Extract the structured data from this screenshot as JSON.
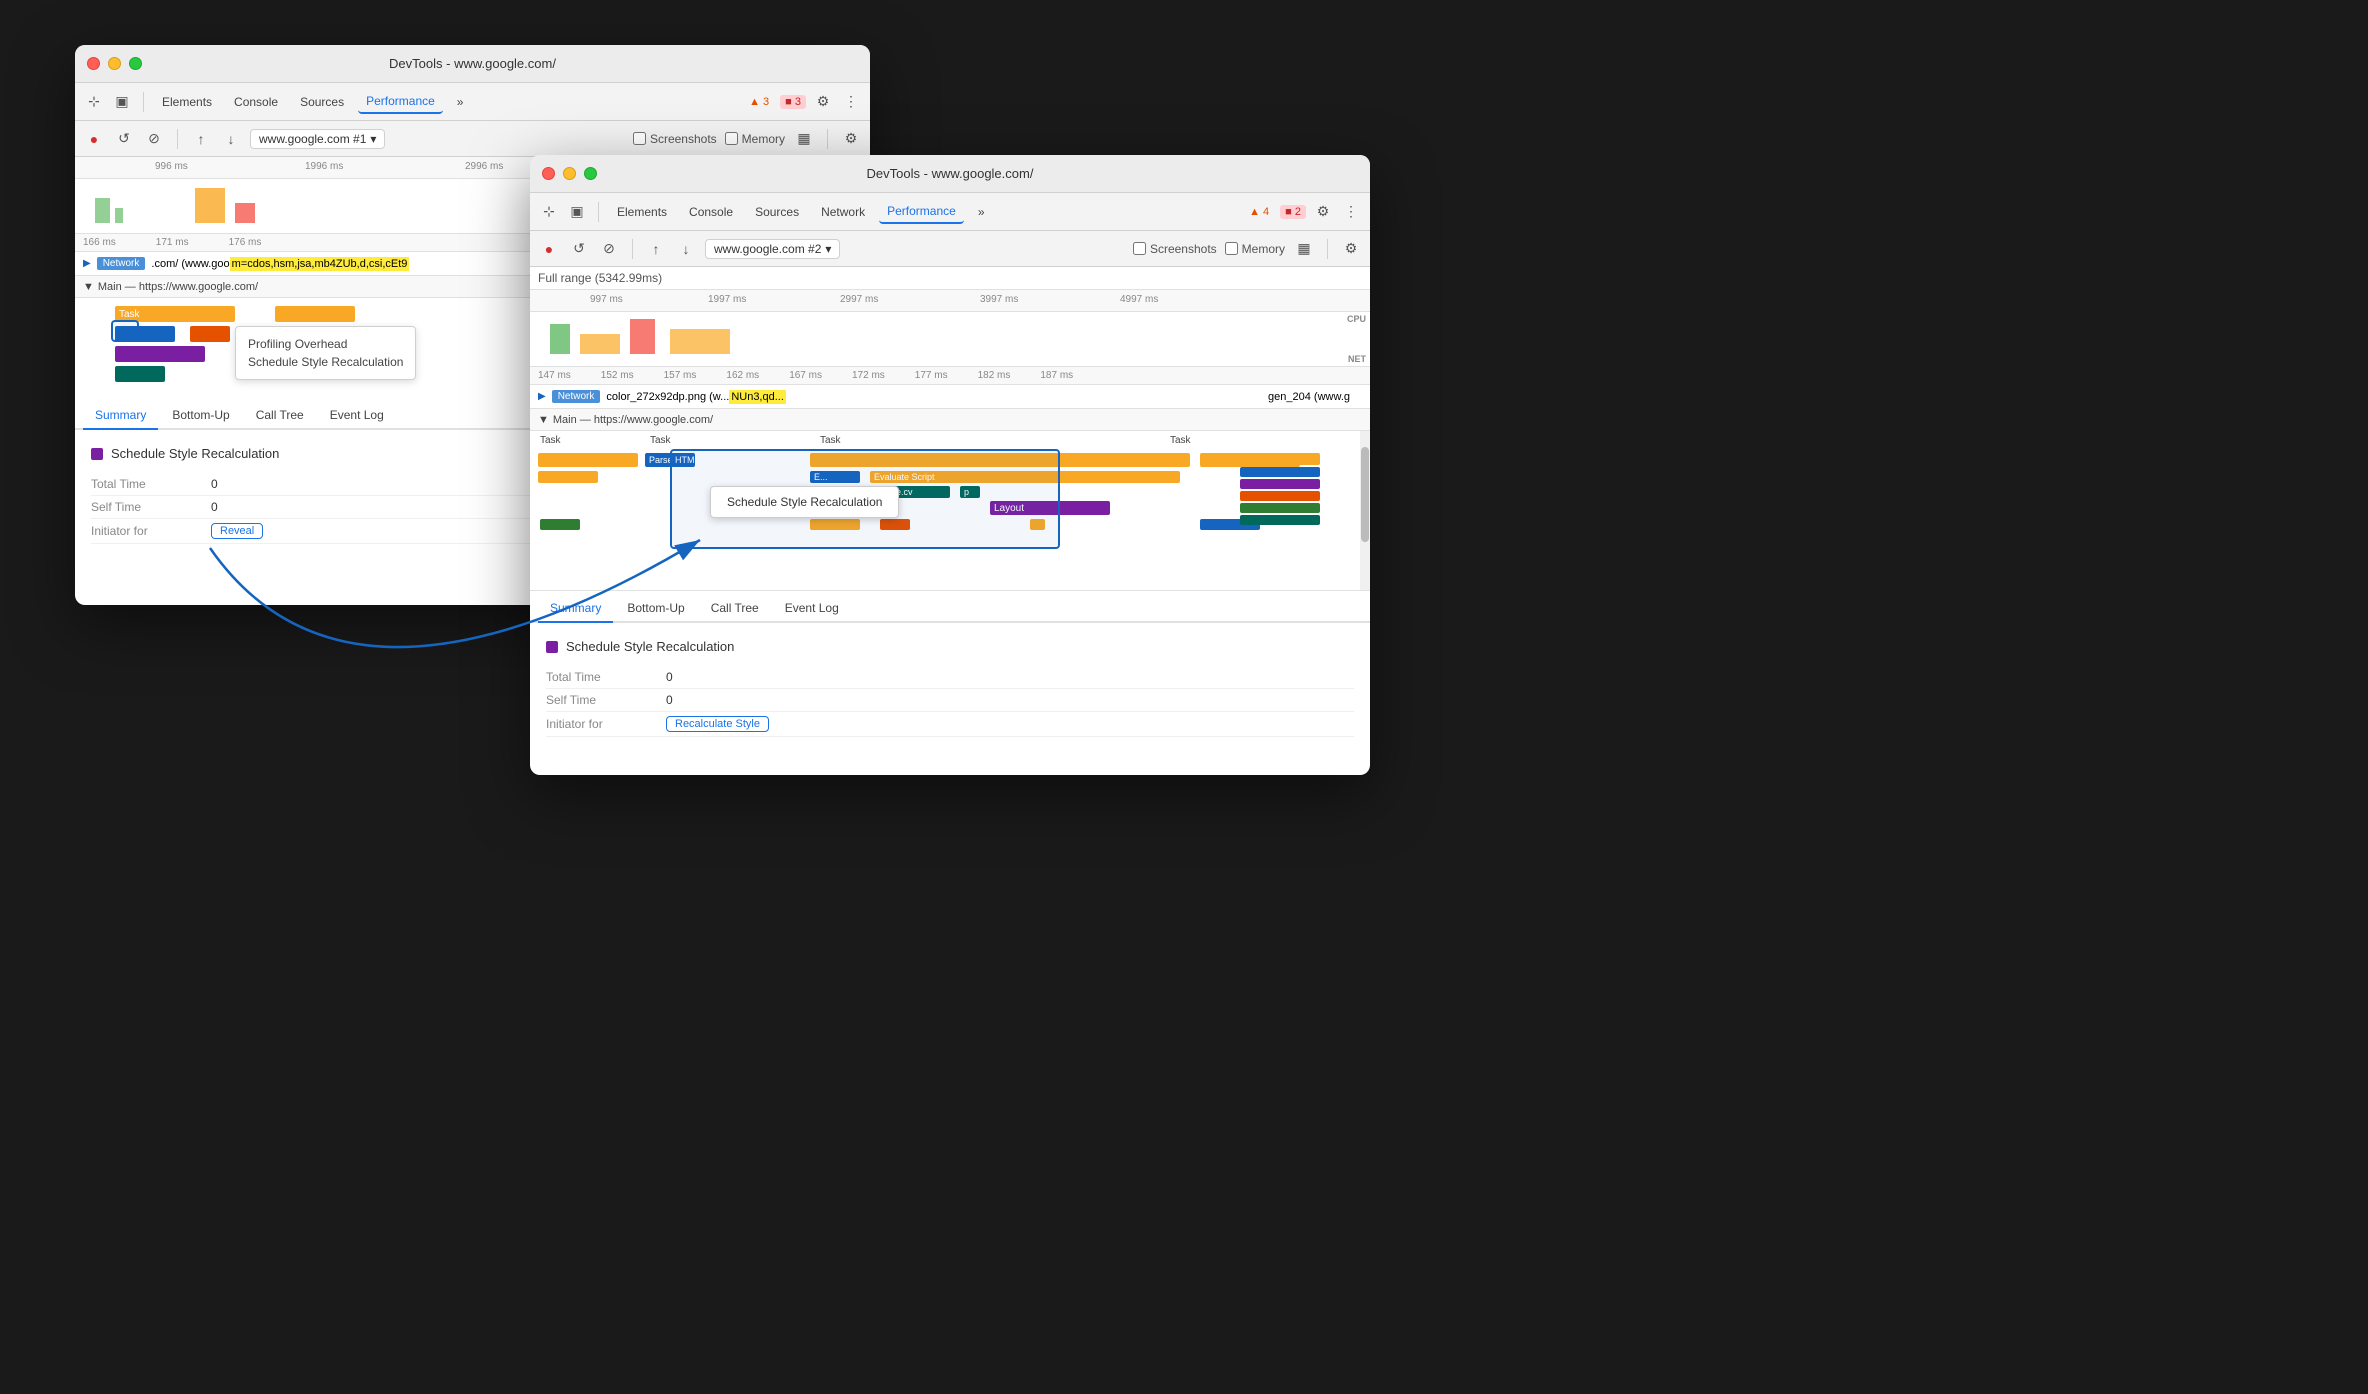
{
  "background_color": "#1a1a1a",
  "window_back": {
    "title": "DevTools - www.google.com/",
    "nav_items": [
      "Elements",
      "Console",
      "Sources",
      "Performance",
      "»"
    ],
    "active_nav": "Performance",
    "warnings": "▲ 3",
    "errors": "■ 3",
    "url": "www.google.com #1",
    "checkboxes": [
      "Screenshots",
      "Memory"
    ],
    "ruler_ticks": [
      "996 ms",
      "1996 ms",
      "2996 ms"
    ],
    "small_ticks": [
      "166 ms",
      "171 ms",
      "176 ms"
    ],
    "network_label": "Network",
    "network_url": ".com/ (www.goo",
    "network_params": "m=cdos,hsm,jsa,mb4ZUb,d,csi,cEt9",
    "main_label": "Main — https://www.google.com/",
    "task_label": "Task",
    "tooltip_items": [
      "Profiling Overhead",
      "Schedule Style Recalculation"
    ],
    "tabs": [
      "Summary",
      "Bottom-Up",
      "Call Tree",
      "Event Log"
    ],
    "active_tab": "Summary",
    "summary_title": "Schedule Style Recalculation",
    "total_time_label": "Total Time",
    "total_time_value": "0",
    "self_time_label": "Self Time",
    "self_time_value": "0",
    "initiator_label": "Initiator for",
    "reveal_label": "Reveal"
  },
  "window_front": {
    "title": "DevTools - www.google.com/",
    "nav_items": [
      "",
      "Elements",
      "Console",
      "Sources",
      "Network",
      "Performance",
      "»"
    ],
    "active_nav": "Performance",
    "warnings": "▲ 4",
    "errors": "■ 2",
    "url": "www.google.com #2",
    "checkboxes": [
      "Screenshots",
      "Memory"
    ],
    "full_range": "Full range (5342.99ms)",
    "ruler_ticks": [
      "997 ms",
      "1997 ms",
      "2997 ms",
      "3997 ms",
      "4997 ms"
    ],
    "cpu_label": "CPU",
    "net_label": "NET",
    "small_ticks": [
      "147 ms",
      "152 ms",
      "157 ms",
      "162 ms",
      "167 ms",
      "172 ms",
      "177 ms",
      "182 ms",
      "187 ms"
    ],
    "network_label": "Network",
    "network_file": "color_272x92dp.png (w...",
    "network_params": "NUn3,qd...",
    "network_right": "gen_204 (www.g",
    "main_label": "Main — https://www.google.com/",
    "task_labels": [
      "Task",
      "Task",
      "Task",
      "Task"
    ],
    "task_subtitles": [
      "Parse HTML",
      "E..."
    ],
    "evaluate_script": "Evaluate Script",
    "google_cv": "google.cv",
    "p_label": "p",
    "layout_label": "Layout",
    "schedule_tooltip": "Schedule Style Recalculation",
    "tabs": [
      "Summary",
      "Bottom-Up",
      "Call Tree",
      "Event Log"
    ],
    "active_tab": "Summary",
    "summary_title": "Schedule Style Recalculation",
    "total_time_label": "Total Time",
    "total_time_value": "0",
    "self_time_label": "Self Time",
    "self_time_value": "0",
    "initiator_label": "Initiator for",
    "recalculate_label": "Recalculate Style"
  },
  "arrow": {
    "description": "Blue arrow connecting back window Reveal button to front window task area"
  }
}
